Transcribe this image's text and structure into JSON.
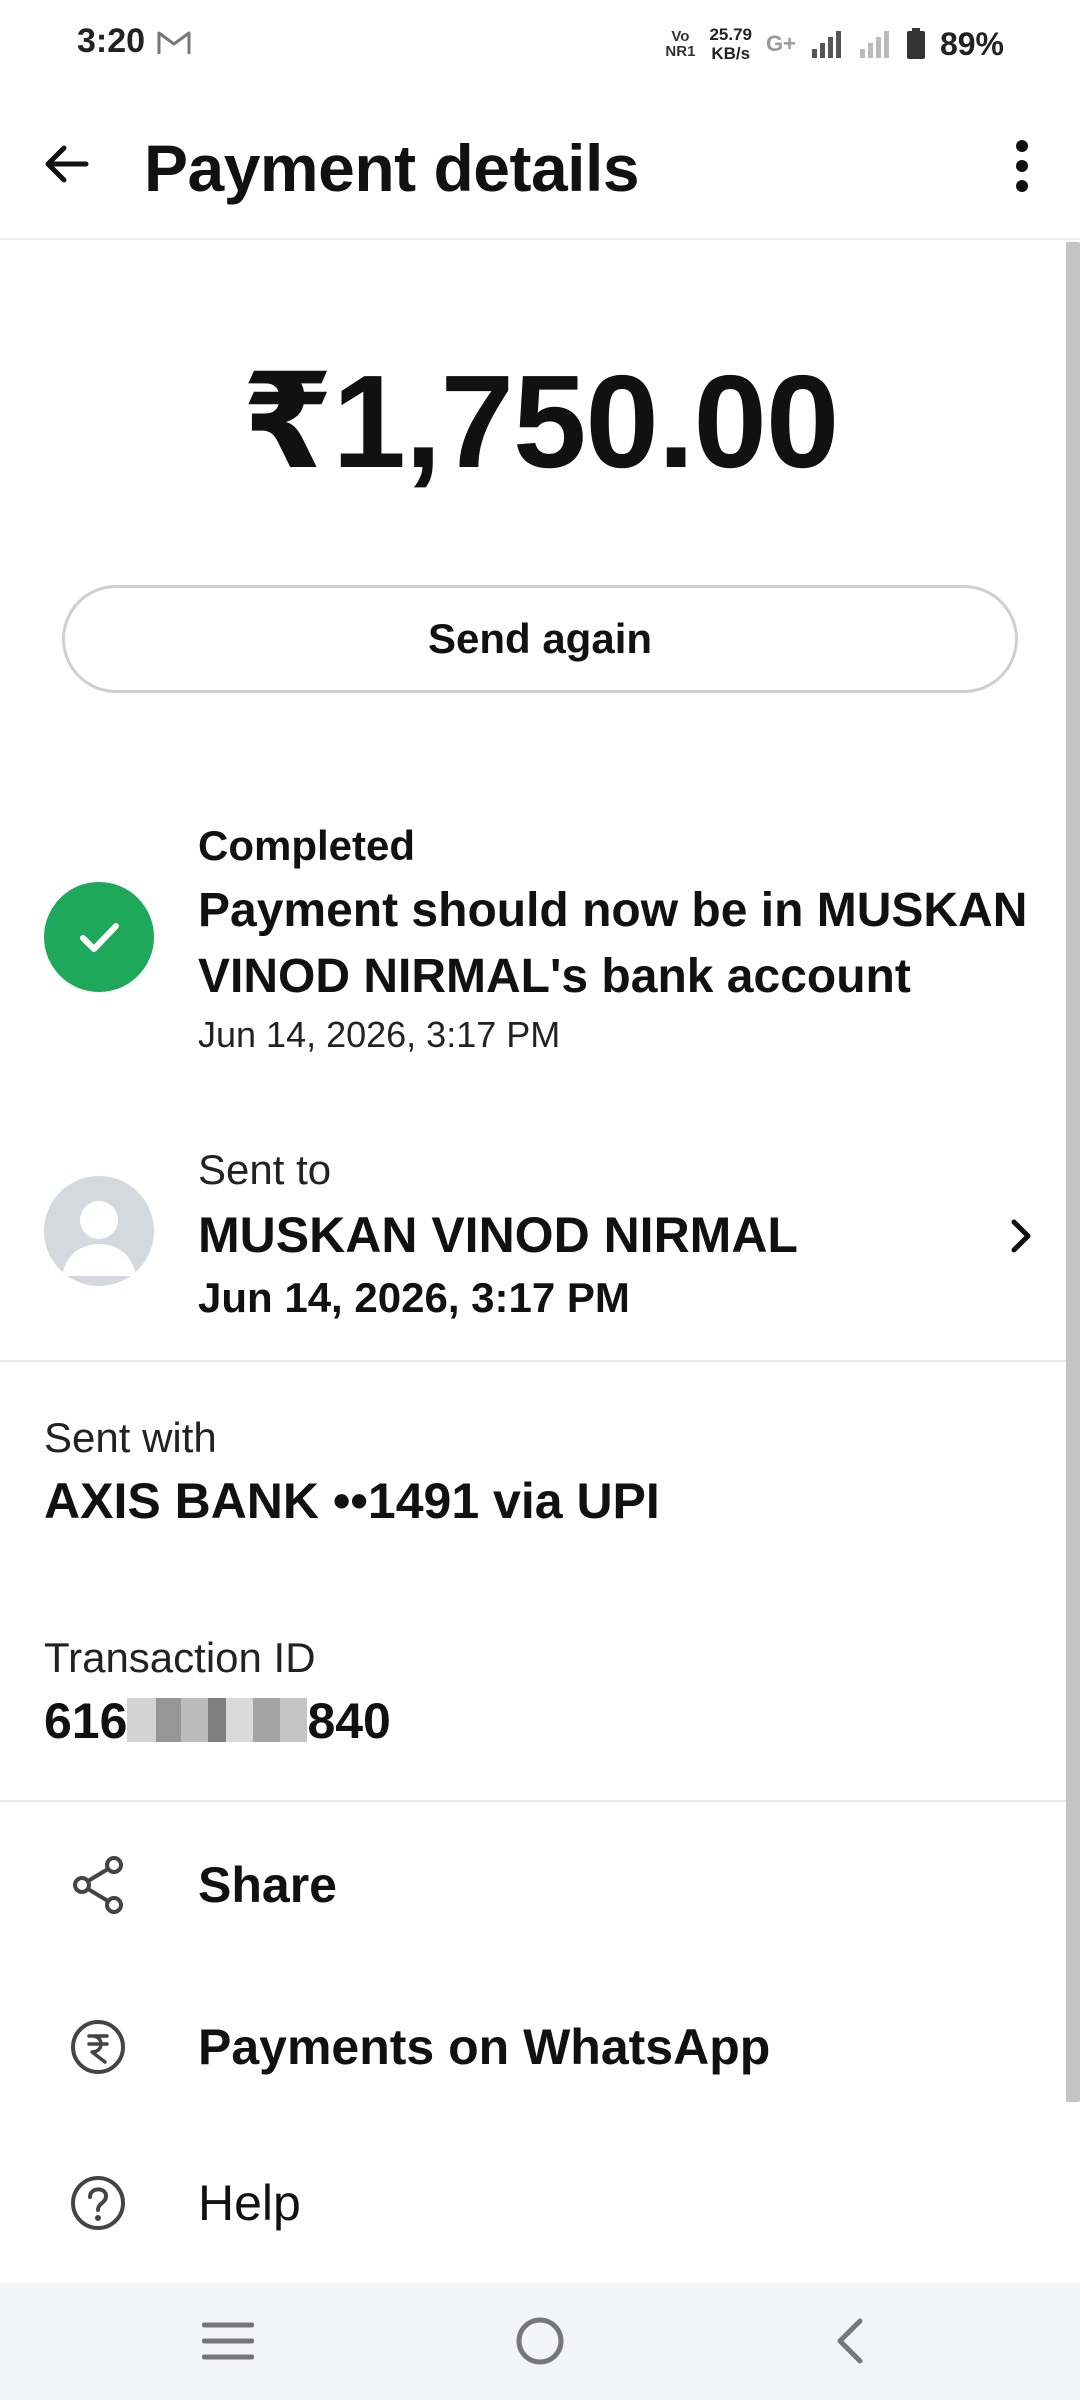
{
  "status_bar": {
    "time": "3:20",
    "volte_top": "Vo",
    "volte_bottom": "NR1",
    "speed_value": "25.79",
    "speed_unit": "KB/s",
    "network_type": "G+",
    "battery_percent": "89%"
  },
  "app_bar": {
    "title": "Payment details"
  },
  "payment": {
    "amount": "₹1,750.00",
    "send_again_label": "Send again"
  },
  "status": {
    "label": "Completed",
    "message": "Payment should now be in MUSKAN VINOD NIRMAL's bank account",
    "timestamp": "Jun 14, 2026, 3:17 PM",
    "color": "#1ea95a"
  },
  "recipient": {
    "label": "Sent to",
    "name": "MUSKAN VINOD NIRMAL",
    "timestamp": "Jun 14, 2026, 3:17 PM"
  },
  "sent_with": {
    "label": "Sent with",
    "value": "AXIS BANK ••1491 via UPI"
  },
  "transaction": {
    "label": "Transaction ID",
    "id_prefix": "616",
    "id_suffix": "840"
  },
  "actions": [
    {
      "label": "Share",
      "icon": "share-icon"
    },
    {
      "label": "Payments on WhatsApp",
      "icon": "rupee-circle-icon"
    },
    {
      "label": "Help",
      "icon": "help-icon"
    }
  ]
}
